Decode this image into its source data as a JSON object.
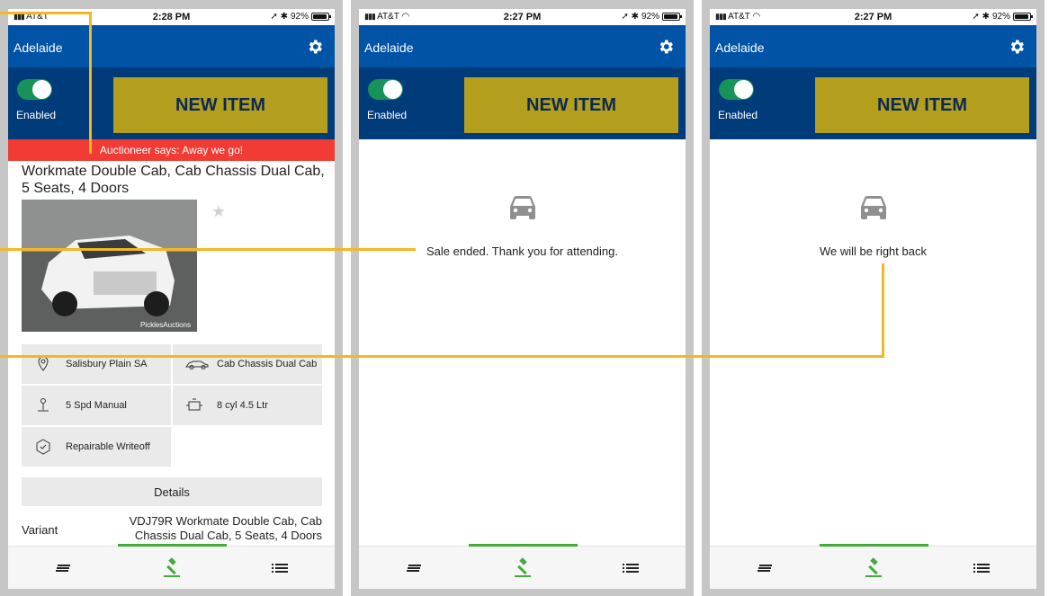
{
  "status_bar": {
    "carrier_partial": "AT&T",
    "carrier": "AT&T",
    "screen1_time": "2:28 PM",
    "time": "2:27 PM",
    "battery": "92%"
  },
  "header": {
    "location": "Adelaide",
    "toggle_label": "Enabled",
    "new_item_label": "NEW ITEM"
  },
  "lot": {
    "banner": "Auctioneer says: Away we go!",
    "title": "Workmate Double Cab, Cab Chassis Dual Cab, 5 Seats, 4 Doors",
    "watermark": "PicklesAuctions",
    "specs": [
      {
        "icon": "location-pin-icon",
        "text": "Salisbury Plain SA"
      },
      {
        "icon": "car-outline-icon",
        "text": "Cab Chassis Dual Cab"
      },
      {
        "icon": "gear-shift-icon",
        "text": "5 Spd Manual"
      },
      {
        "icon": "engine-icon",
        "text": "8 cyl 4.5 Ltr"
      },
      {
        "icon": "check-shield-icon",
        "text": "Repairable Writeoff"
      }
    ],
    "details_label": "Details",
    "variant_label": "Variant",
    "variant_value": "VDJ79R Workmate Double Cab, Cab Chassis Dual Cab, 5 Seats, 4 Doors"
  },
  "messages": {
    "sale_ended": "Sale ended. Thank you for attending.",
    "right_back": "We will be right back"
  },
  "colors": {
    "title_bar": "#0053a5",
    "control_bar": "#003b7a",
    "new_item_button": "#b39e1d",
    "banner": "#f23b34",
    "toggle_on": "#17935a",
    "active_tab": "#44aa3a",
    "annotation_line": "#f5b721"
  }
}
